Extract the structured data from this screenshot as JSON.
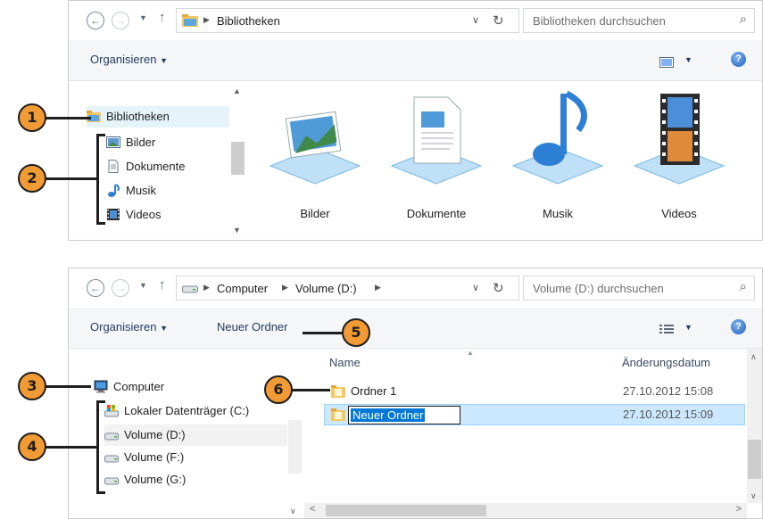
{
  "window1": {
    "breadcrumb": [
      "Bibliotheken"
    ],
    "search_placeholder": "Bibliotheken durchsuchen",
    "toolbar": {
      "organize": "Organisieren",
      "organize_arrow": "▼"
    },
    "nav": {
      "root": "Bibliotheken",
      "items": [
        "Bilder",
        "Dokumente",
        "Musik",
        "Videos"
      ]
    },
    "libraries": [
      {
        "label": "Bilder",
        "icon": "pictures-library-icon"
      },
      {
        "label": "Dokumente",
        "icon": "documents-library-icon"
      },
      {
        "label": "Musik",
        "icon": "music-library-icon"
      },
      {
        "label": "Videos",
        "icon": "videos-library-icon"
      }
    ]
  },
  "window2": {
    "breadcrumb": [
      "Computer",
      "Volume (D:)"
    ],
    "search_placeholder": "Volume (D:) durchsuchen",
    "toolbar": {
      "organize": "Organisieren",
      "organize_arrow": "▼",
      "new_folder": "Neuer Ordner"
    },
    "nav": {
      "root": "Computer",
      "items": [
        "Lokaler Datenträger (C:)",
        "Volume (D:)",
        "Volume (F:)",
        "Volume (G:)"
      ]
    },
    "columns": {
      "name": "Name",
      "date": "Änderungsdatum"
    },
    "files": [
      {
        "name": "Ordner 1",
        "date": "27.10.2012 15:08"
      },
      {
        "name": "Neuer Ordner",
        "date": "27.10.2012 15:09",
        "renaming": true
      }
    ]
  },
  "callouts": [
    "1",
    "2",
    "3",
    "4",
    "5",
    "6"
  ],
  "colors": {
    "callout": "#f29a33",
    "selection": "#cce8ff",
    "rename_highlight": "#0078d7",
    "link_text": "#1e3a5f"
  }
}
